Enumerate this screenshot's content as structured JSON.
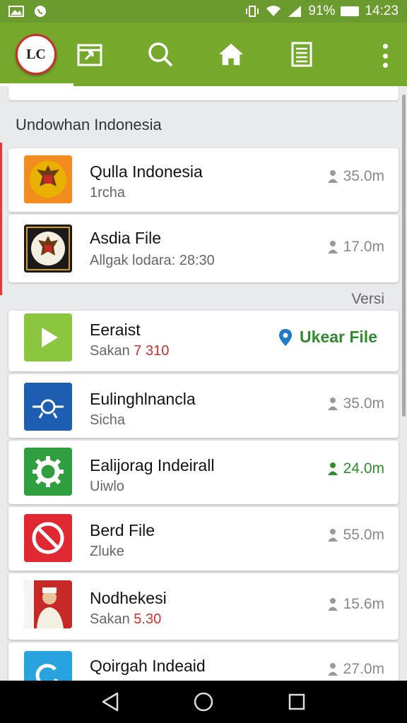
{
  "status_bar": {
    "battery": "91%",
    "time": "14:23"
  },
  "app_bar": {
    "logo_text": "LC",
    "icons": [
      "calendar-icon",
      "search-icon",
      "home-icon",
      "document-icon",
      "more-icon"
    ]
  },
  "section": {
    "title": "Undowhan Indonesia",
    "versi_label": "Versi"
  },
  "apps": [
    {
      "title": "Qulla Indonesia",
      "subtitle": "1rcha",
      "subtitle_highlight": "",
      "size": "35.0m",
      "size_color": "gray",
      "icon": "garuda-emblem-icon",
      "icon_bg": "#f5a623"
    },
    {
      "title": "Asdia File",
      "subtitle": "Allgak lodara: 28:30",
      "subtitle_highlight": "",
      "size": "17.0m",
      "size_color": "gray",
      "icon": "garuda-seal-icon",
      "icon_bg": "#1a1a1a"
    },
    {
      "title": "Eeraist",
      "subtitle": "Sakan",
      "subtitle_highlight": "7 310",
      "action": "Ukear File",
      "icon": "play-icon",
      "icon_bg": "#8cc63f"
    },
    {
      "title": "Eulinghlnancla",
      "subtitle": "Sicha",
      "subtitle_highlight": "",
      "size": "35.0m",
      "size_color": "gray",
      "icon": "target-icon",
      "icon_bg": "#1e5eb0"
    },
    {
      "title": "Ealijorag Indeirall",
      "subtitle": "Uiwlo",
      "subtitle_highlight": "",
      "size": "24.0m",
      "size_color": "green",
      "icon": "gear-icon",
      "icon_bg": "#2e9e3e"
    },
    {
      "title": "Berd File",
      "subtitle": "Zluke",
      "subtitle_highlight": "",
      "size": "55.0m",
      "size_color": "gray",
      "icon": "block-icon",
      "icon_bg": "#e02833"
    },
    {
      "title": "Nodhekesi",
      "subtitle": "Sakan",
      "subtitle_highlight": "5.30",
      "size": "15.6m",
      "size_color": "gray",
      "icon": "portrait-icon",
      "icon_bg": "#c62828"
    },
    {
      "title": "Qoirgah Indeaid",
      "subtitle": "",
      "subtitle_highlight": "",
      "size": "27.0m",
      "size_color": "gray",
      "icon": "refresh-icon",
      "icon_bg": "#29a3e0"
    }
  ]
}
